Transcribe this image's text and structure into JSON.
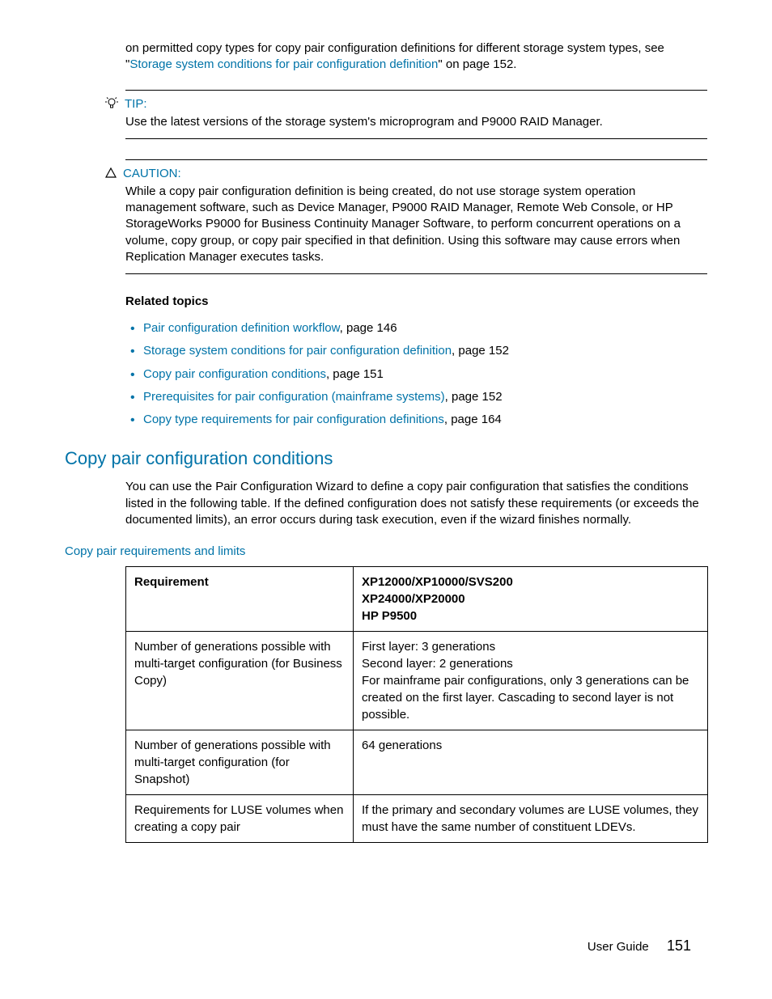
{
  "intro": {
    "text_before_link": "on permitted copy types for copy pair configuration definitions for different storage system types, see \"",
    "link_text": "Storage system conditions for pair configuration definition",
    "text_after_link": "\" on page 152."
  },
  "tip": {
    "label": "TIP:",
    "body": "Use the latest versions of the storage system's microprogram and P9000 RAID Manager."
  },
  "caution": {
    "label": "CAUTION:",
    "body": "While a copy pair configuration definition is being created, do not use storage system operation management software, such as Device Manager, P9000 RAID Manager, Remote Web Console, or HP StorageWorks P9000 for Business Continuity Manager Software, to perform concurrent operations on a volume, copy group, or copy pair specified in that definition. Using this software may cause errors when Replication Manager executes tasks."
  },
  "related": {
    "heading": "Related topics",
    "items": [
      {
        "link": "Pair configuration definition workflow",
        "suffix": ", page 146"
      },
      {
        "link": "Storage system conditions for pair configuration definition",
        "suffix": ", page 152"
      },
      {
        "link": "Copy pair configuration conditions",
        "suffix": ", page 151"
      },
      {
        "link": "Prerequisites for pair configuration (mainframe systems)",
        "suffix": ", page 152"
      },
      {
        "link": "Copy type requirements for pair configuration definitions",
        "suffix": ", page 164"
      }
    ]
  },
  "section": {
    "heading": "Copy pair configuration conditions",
    "body": "You can use the Pair Configuration Wizard to define a copy pair configuration that satisfies the conditions listed in the following table. If the defined configuration does not satisfy these requirements (or exceeds the documented limits), an error occurs during task execution, even if the wizard finishes normally."
  },
  "table": {
    "caption": "Copy pair requirements and limits",
    "headers": {
      "col1": "Requirement",
      "col2_line1": "XP12000/XP10000/SVS200",
      "col2_line2": "XP24000/XP20000",
      "col2_line3": "HP P9500"
    },
    "rows": [
      {
        "req": "Number of generations possible with multi-target configuration (for Business Copy)",
        "val_line1": "First layer: 3 generations",
        "val_line2": "Second layer: 2 generations",
        "val_line3": "For mainframe pair configurations, only 3 generations can be created on the first layer. Cascading to second layer is not possible."
      },
      {
        "req": "Number of generations possible with multi-target configuration (for Snapshot)",
        "val": "64 generations"
      },
      {
        "req": "Requirements for LUSE volumes when creating a copy pair",
        "val": "If the primary and secondary volumes are LUSE volumes, they must have the same number of constituent LDEVs."
      }
    ]
  },
  "footer": {
    "label": "User Guide",
    "page": "151"
  }
}
